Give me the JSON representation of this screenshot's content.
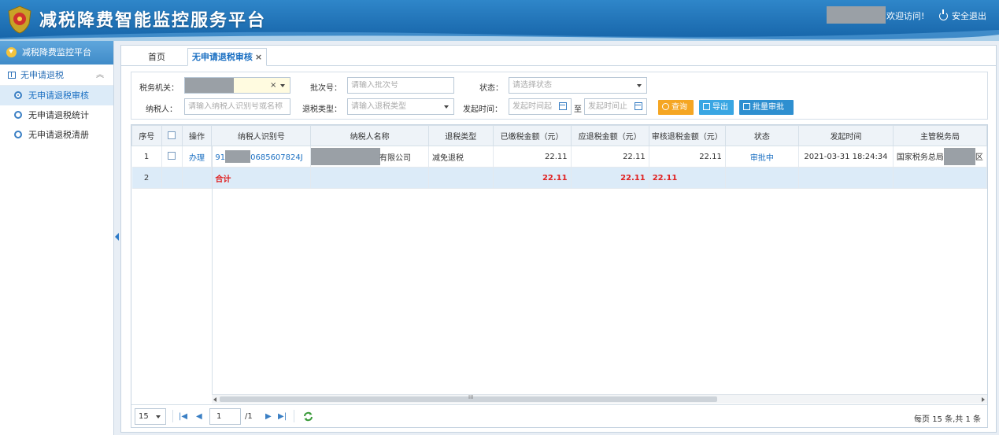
{
  "header": {
    "title": "减税降费智能监控服务平台",
    "welcome": "欢迎访问!",
    "logout": "安全退出"
  },
  "sidebar": {
    "platform": "减税降费监控平台",
    "group": "无申请退税",
    "items": [
      {
        "label": "无申请退税审核",
        "active": true
      },
      {
        "label": "无申请退税统计",
        "active": false
      },
      {
        "label": "无申请退税清册",
        "active": false
      }
    ]
  },
  "tabs": [
    {
      "label": "首页"
    },
    {
      "label": "无申请退税审核",
      "close": "×"
    }
  ],
  "filters": {
    "tax_office_label": "税务机关：",
    "batch_label": "批次号：",
    "batch_placeholder": "请输入批次号",
    "status_label": "状态：",
    "status_placeholder": "请选择状态",
    "taxpayer_label": "纳税人：",
    "taxpayer_placeholder": "请输入纳税人识别号或名称",
    "refund_type_label": "退税类型：",
    "refund_type_placeholder": "请输入退税类型",
    "date_label": "发起时间：",
    "date_from_placeholder": "发起时间起",
    "date_to_sep": "至",
    "date_to_placeholder": "发起时间止",
    "clear": "×",
    "query": "查询",
    "export": "导出",
    "batch_review": "批量审批"
  },
  "table": {
    "columns": [
      "序号",
      "",
      "操作",
      "纳税人识别号",
      "纳税人名称",
      "退税类型",
      "已缴税金额（元）",
      "应退税金额（元）",
      "审核退税金额（元）",
      "状态",
      "发起时间",
      "主管税务局"
    ],
    "rows": [
      {
        "seq": "1",
        "action": "办理",
        "id_prefix": "91",
        "id_suffix": "0685607824J",
        "name_suffix": "有限公司",
        "type": "减免退税",
        "paid": "22.11",
        "refund": "22.11",
        "approved": "22.11",
        "status": "审批中",
        "time": "2021-03-31 18:24:34",
        "office_prefix": "国家税务总局",
        "office_suffix": "区"
      },
      {
        "seq": "2",
        "total_label": "合计",
        "paid": "22.11",
        "refund": "22.11",
        "approved": "22.11"
      }
    ]
  },
  "pager": {
    "page_size": "15",
    "current": "1",
    "total_pages": "/1",
    "summary": "每页 15 条,共 1 条",
    "scroll_mid": "III"
  }
}
